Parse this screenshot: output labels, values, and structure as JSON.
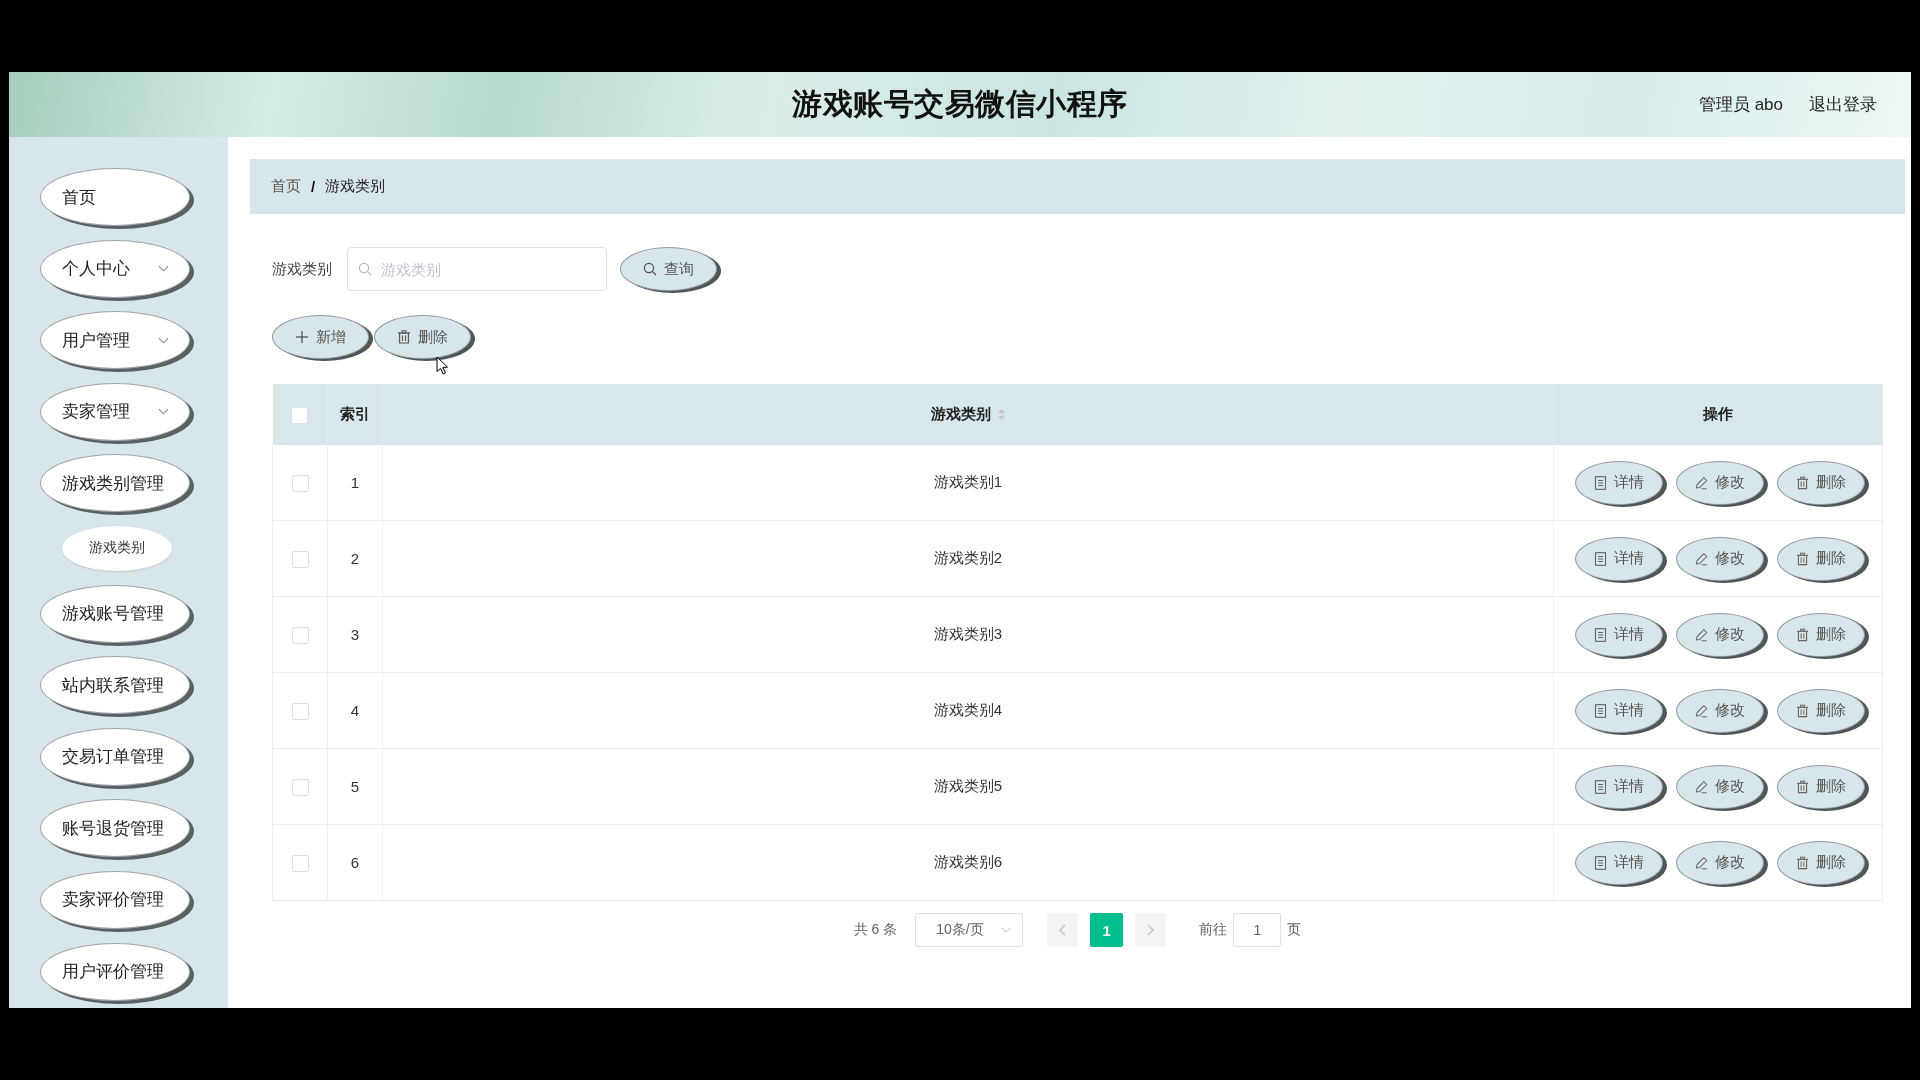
{
  "header": {
    "title": "游戏账号交易微信小程序",
    "user": "管理员 abo",
    "logout": "退出登录"
  },
  "sidebar": {
    "items": [
      {
        "label": "首页",
        "chevron": false
      },
      {
        "label": "个人中心",
        "chevron": true
      },
      {
        "label": "用户管理",
        "chevron": true
      },
      {
        "label": "卖家管理",
        "chevron": true
      },
      {
        "label": "游戏类别管理",
        "chevron": false,
        "children": [
          {
            "label": "游戏类别"
          }
        ]
      },
      {
        "label": "游戏账号管理",
        "chevron": false
      },
      {
        "label": "站内联系管理",
        "chevron": false
      },
      {
        "label": "交易订单管理",
        "chevron": false
      },
      {
        "label": "账号退货管理",
        "chevron": false
      },
      {
        "label": "卖家评价管理",
        "chevron": false
      },
      {
        "label": "用户评价管理",
        "chevron": false
      }
    ]
  },
  "breadcrumb": {
    "items": [
      "首页",
      "游戏类别"
    ],
    "separator": "/"
  },
  "search": {
    "label": "游戏类别",
    "placeholder": "游戏类别",
    "button": "查询"
  },
  "toolbar": [
    {
      "label": "新增",
      "kind": "add"
    },
    {
      "label": "删除",
      "kind": "delete"
    }
  ],
  "table": {
    "select_all_checked": false,
    "columns": [
      {
        "label": "索引",
        "sortable": false
      },
      {
        "label": "游戏类别",
        "sortable": true
      },
      {
        "label": "操作",
        "sortable": false
      }
    ],
    "rows": [
      {
        "checked": false,
        "index": "1",
        "category": "游戏类别1",
        "actions": [
          {
            "label": "详情",
            "kind": "detail"
          },
          {
            "label": "修改",
            "kind": "edit"
          },
          {
            "label": "删除",
            "kind": "delete"
          }
        ]
      },
      {
        "checked": false,
        "index": "2",
        "category": "游戏类别2",
        "actions": [
          {
            "label": "详情",
            "kind": "detail"
          },
          {
            "label": "修改",
            "kind": "edit"
          },
          {
            "label": "删除",
            "kind": "delete"
          }
        ]
      },
      {
        "checked": false,
        "index": "3",
        "category": "游戏类别3",
        "actions": [
          {
            "label": "详情",
            "kind": "detail"
          },
          {
            "label": "修改",
            "kind": "edit"
          },
          {
            "label": "删除",
            "kind": "delete"
          }
        ]
      },
      {
        "checked": false,
        "index": "4",
        "category": "游戏类别4",
        "actions": [
          {
            "label": "详情",
            "kind": "detail"
          },
          {
            "label": "修改",
            "kind": "edit"
          },
          {
            "label": "删除",
            "kind": "delete"
          }
        ]
      },
      {
        "checked": false,
        "index": "5",
        "category": "游戏类别5",
        "actions": [
          {
            "label": "详情",
            "kind": "detail"
          },
          {
            "label": "修改",
            "kind": "edit"
          },
          {
            "label": "删除",
            "kind": "delete"
          }
        ]
      },
      {
        "checked": false,
        "index": "6",
        "category": "游戏类别6",
        "actions": [
          {
            "label": "详情",
            "kind": "detail"
          },
          {
            "label": "修改",
            "kind": "edit"
          },
          {
            "label": "删除",
            "kind": "delete"
          }
        ]
      }
    ]
  },
  "pagination": {
    "total": "共 6 条",
    "page_size": "10条/页",
    "pages": [
      {
        "label": "1",
        "selected": true
      }
    ],
    "goto_label": "前往",
    "goto_value": "1",
    "page_unit": "页"
  }
}
